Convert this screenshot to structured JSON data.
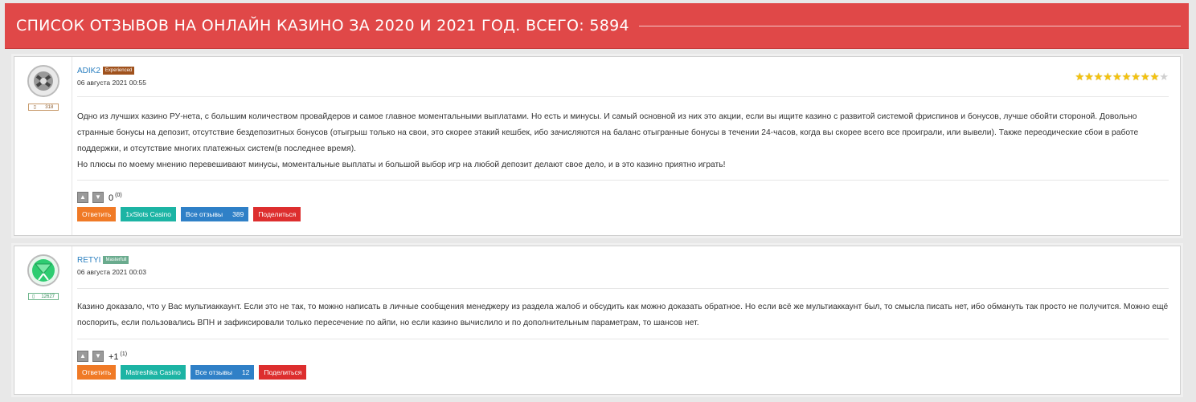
{
  "header": {
    "title": "СПИСОК ОТЗЫВОВ НА ОНЛАЙН КАЗИНО ЗА 2020 И 2021 ГОД. ВСЕГО: 5894"
  },
  "reviews": [
    {
      "author": "ADIK2",
      "status": "Experienced",
      "date": "06 августа 2021 00:55",
      "rank_value": "318",
      "rating": 9,
      "rating_max": 10,
      "paragraphs": [
        "Одно из лучших казино РУ-нета, с большим количеством провайдеров и самое главное моментальными выплатами. Но есть и минусы. И самый основной из них это акции, если вы ищите казино с развитой системой фриспинов и бонусов, лучше обойти стороной. Довольно странные бонусы на депозит, отсутствие бездепозитных бонусов (отыгрыш только на свои, это скорее этакий кешбек, ибо зачисляются на баланс отыгранные бонусы в течении 24-часов, когда вы скорее всего все проиграли, или вывели). Также переодические сбои в работе поддержки, и отсутствие многих платежных систем(в последнее время).",
        "Но плюсы по моему мнению перевешивают минусы, моментальные выплаты и большой выбор игр на любой депозит делают свое дело, и в это казино приятно играть!"
      ],
      "score": "0",
      "score_count": "(0)",
      "reply_label": "Ответить",
      "casino_label": "1xSlots Casino",
      "all_reviews_label": "Все отзывы",
      "all_reviews_count": "389",
      "share_label": "Поделиться"
    },
    {
      "author": "RETYI",
      "status": "Masterfull",
      "date": "06 августа 2021 00:03",
      "rank_value": "12627",
      "paragraphs": [
        "Казино доказало, что у Вас мультиаккаунт. Если это не так, то можно написать в личные сообщения менеджеру из раздела жалоб и обсудить как можно доказать обратное. Но если всё же мультиаккаунт был, то смысла писать нет, ибо обмануть так просто не получится. Можно ещё поспорить, если пользовались ВПН и зафиксировали только пересечение по айпи, но если казино вычислило и по дополнительным параметрам, то шансов нет."
      ],
      "score": "+1",
      "score_count": "(1)",
      "reply_label": "Ответить",
      "casino_label": "Matreshka Casino",
      "all_reviews_label": "Все отзывы",
      "all_reviews_count": "12",
      "share_label": "Поделиться"
    }
  ],
  "icons": {
    "thumb_up": "thumb-up-icon",
    "thumb_down": "thumb-down-icon",
    "star": "star-icon"
  },
  "colors": {
    "header_bg": "#e04848",
    "btn_reply": "#f07a26",
    "btn_casino": "#1cb4a4",
    "btn_all": "#2f80c7",
    "btn_share": "#dd2e2e",
    "star_on": "#f4c20d"
  }
}
